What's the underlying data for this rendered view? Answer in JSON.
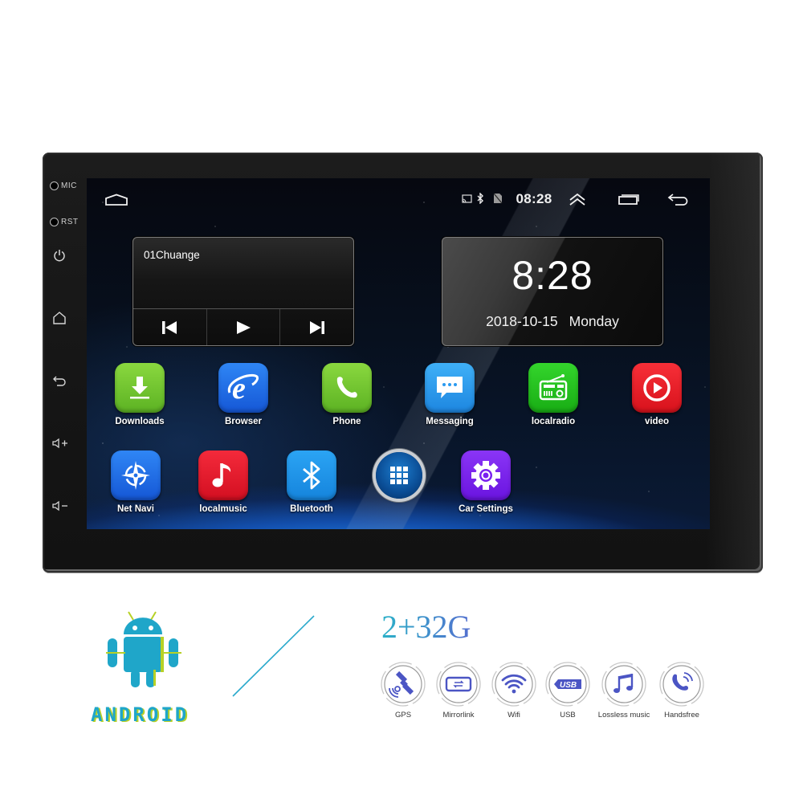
{
  "device": {
    "side_buttons": [
      {
        "name": "mic",
        "label": "MIC"
      },
      {
        "name": "rst",
        "label": "RST"
      },
      {
        "name": "power",
        "icon": "power-icon"
      },
      {
        "name": "home",
        "icon": "home-icon"
      },
      {
        "name": "back",
        "icon": "back-icon"
      },
      {
        "name": "volume-up",
        "icon": "volume-up-icon"
      },
      {
        "name": "volume-down",
        "icon": "volume-down-icon"
      }
    ]
  },
  "status_bar": {
    "time": "08:28",
    "icons": [
      "cast-icon",
      "bluetooth-icon",
      "no-sim-icon"
    ],
    "nav": [
      "home-icon",
      "expand-up-icon",
      "recent-apps-icon",
      "back-icon"
    ]
  },
  "music_widget": {
    "track": "01Chuange",
    "controls": [
      "previous-icon",
      "play-icon",
      "next-icon"
    ]
  },
  "clock_widget": {
    "time": "8:28",
    "date": "2018-10-15",
    "day": "Monday"
  },
  "apps": [
    {
      "label": "Downloads",
      "icon": "download-icon",
      "color": "#6cc62a"
    },
    {
      "label": "Browser",
      "icon": "browser-e-icon",
      "color": "#1f6fe8"
    },
    {
      "label": "Phone",
      "icon": "phone-icon",
      "color": "#6cc62a"
    },
    {
      "label": "Messaging",
      "icon": "message-icon",
      "color": "#2a9af0"
    },
    {
      "label": "localradio",
      "icon": "radio-icon",
      "color": "#23c11e"
    },
    {
      "label": "video",
      "icon": "video-play-icon",
      "color": "#ee1c25"
    },
    {
      "label": "Net Navi",
      "icon": "compass-icon",
      "color": "#1f6fe8"
    },
    {
      "label": "localmusic",
      "icon": "music-note-icon",
      "color": "#e8192c"
    },
    {
      "label": "Bluetooth",
      "icon": "bluetooth-icon",
      "color": "#1a90ea"
    },
    {
      "label": "",
      "icon": "all-apps-grid-icon",
      "color": "#0a4c94"
    },
    {
      "label": "Car Settings",
      "icon": "gear-icon",
      "color": "#7a1ff0"
    }
  ],
  "marketing": {
    "os_word": "ANDROID",
    "spec": "2+32G",
    "features": [
      {
        "label": "GPS",
        "icon": "gps-satellite-icon"
      },
      {
        "label": "Mirrorlink",
        "icon": "mirrorlink-icon"
      },
      {
        "label": "Wifi",
        "icon": "wifi-icon"
      },
      {
        "label": "USB",
        "icon": "usb-icon"
      },
      {
        "label": "Lossless music",
        "icon": "music-note-icon"
      },
      {
        "label": "Handsfree",
        "icon": "handsfree-phone-icon"
      }
    ],
    "accent_colors": {
      "teal": "#1fa6c9",
      "lime": "#b7d126",
      "indigo": "#5259c8"
    }
  }
}
